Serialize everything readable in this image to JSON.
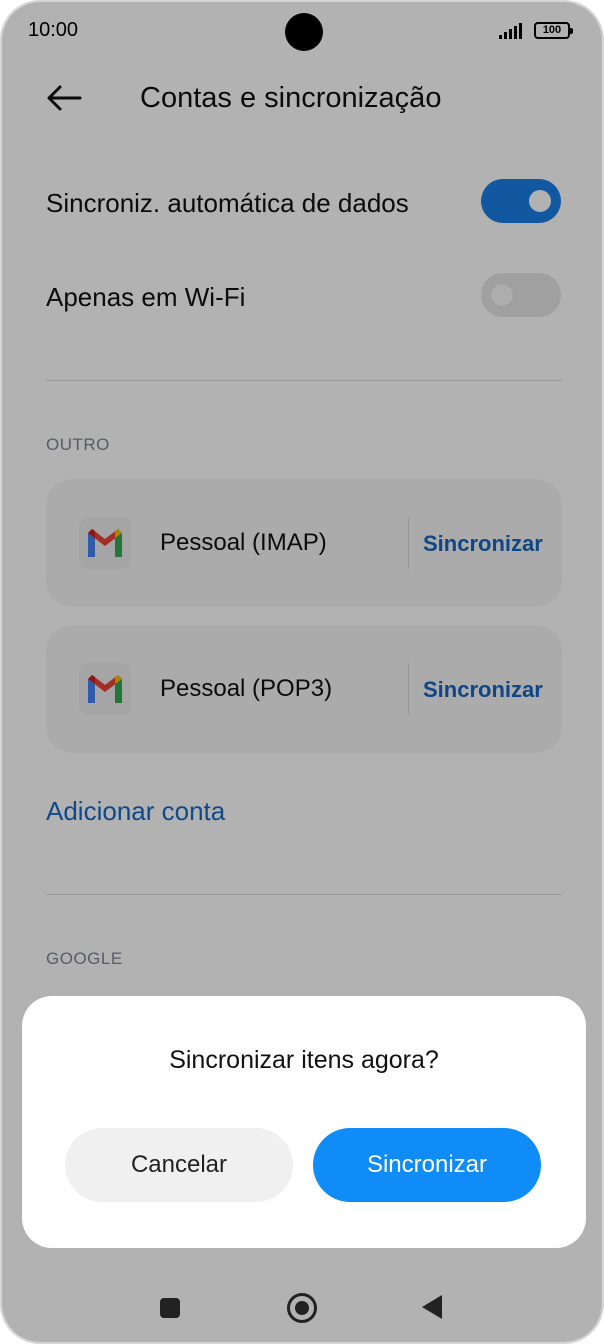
{
  "status_bar": {
    "time": "10:00",
    "battery": "100"
  },
  "header": {
    "title": "Contas e sincronização"
  },
  "settings": {
    "auto_sync": {
      "label": "Sincroniz. automática de dados",
      "enabled": true
    },
    "wifi_only": {
      "label": "Apenas em Wi-Fi",
      "enabled": false
    }
  },
  "sections": {
    "other_label": "OUTRO",
    "google_label": "GOOGLE"
  },
  "accounts": [
    {
      "name": "Pessoal (IMAP)",
      "action": "Sincronizar",
      "icon": "gmail-icon"
    },
    {
      "name": "Pessoal (POP3)",
      "action": "Sincronizar",
      "icon": "gmail-icon"
    }
  ],
  "add_account_label": "Adicionar conta",
  "dialog": {
    "title": "Sincronizar itens agora?",
    "cancel_label": "Cancelar",
    "confirm_label": "Sincronizar"
  },
  "colors": {
    "accent": "#1a7fe6",
    "link": "#1565c0",
    "confirm_button": "#108cf8",
    "scrim": "rgba(0,0,0,0.3)"
  }
}
